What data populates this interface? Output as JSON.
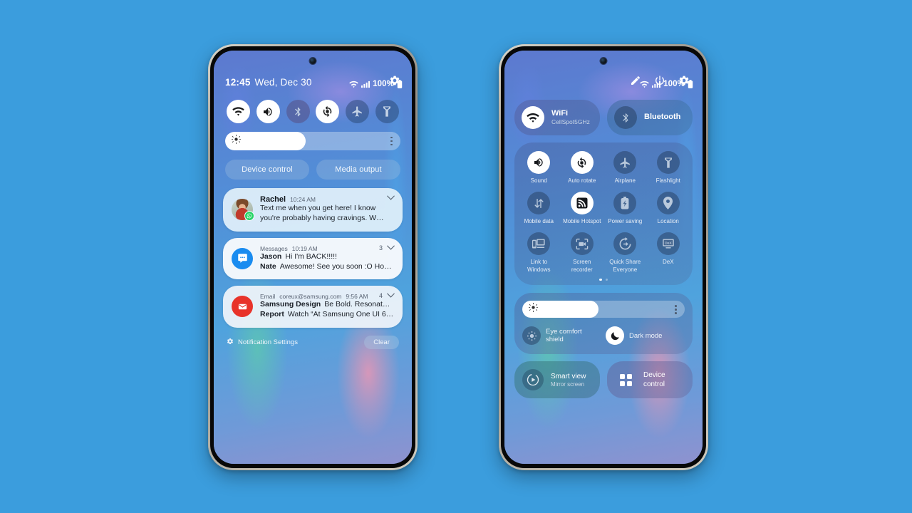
{
  "canvas": {
    "background_color": "#3b9ddd"
  },
  "left_phone": {
    "status_bar": {
      "battery": "100%",
      "icons": [
        "wifi-icon",
        "signal-icon",
        "battery-icon"
      ]
    },
    "quick_panel": {
      "time": "12:45",
      "date": "Wed, Dec 30",
      "settings_icon": "gear-icon",
      "toggles": [
        {
          "name": "wifi",
          "icon": "wifi-icon",
          "active": true
        },
        {
          "name": "sound",
          "icon": "sound-icon",
          "active": true
        },
        {
          "name": "bluetooth",
          "icon": "bluetooth-icon",
          "active": false
        },
        {
          "name": "auto-rotate",
          "icon": "auto-rotate-icon",
          "active": true
        },
        {
          "name": "airplane",
          "icon": "airplane-icon",
          "active": false
        },
        {
          "name": "flashlight",
          "icon": "flashlight-icon",
          "active": false
        }
      ],
      "brightness": {
        "value_percent": 46,
        "icon": "brightness-icon",
        "menu_icon": "more-vertical-icon"
      },
      "buttons": [
        {
          "label": "Device control"
        },
        {
          "label": "Media output"
        }
      ]
    },
    "notifications": [
      {
        "app": "",
        "sender": "Rachel",
        "time": "10:24 AM",
        "count": "",
        "icon": "avatar",
        "badge": "whatsapp-badge-icon",
        "lines": [
          {
            "name": "",
            "text": "Text me when you get here! I know"
          },
          {
            "name": "",
            "text": "you're probably having cravings. W…"
          }
        ]
      },
      {
        "app": "Messages",
        "sender": "",
        "time": "10:19 AM",
        "count": "3",
        "icon": "messages-icon",
        "badge": "",
        "lines": [
          {
            "name": "Jason",
            "text": "Hi I'm BACK!!!!!"
          },
          {
            "name": "Nate",
            "text": "Awesome! See you soon :O Hop…"
          }
        ]
      },
      {
        "app": "Email",
        "sender": "coreux@samsung.com",
        "time": "9:56 AM",
        "count": "4",
        "icon": "email-icon",
        "badge": "",
        "lines": [
          {
            "name": "Samsung Design",
            "text": "Be Bold. Resonate w…"
          },
          {
            "name": "Report",
            "text": "Watch “At Samsung One UI 6.0…"
          }
        ]
      }
    ],
    "notification_footer": {
      "settings_label": "Notification Settings",
      "settings_icon": "gear-icon",
      "clear_label": "Clear"
    },
    "nav_bar": {
      "recents": "recents-icon",
      "home": "home-icon",
      "back": "back-icon"
    }
  },
  "right_phone": {
    "status_bar": {
      "battery": "100%",
      "icons": [
        "wifi-icon",
        "signal-icon",
        "battery-icon"
      ]
    },
    "header_actions": [
      {
        "name": "edit",
        "icon": "pencil-icon"
      },
      {
        "name": "power",
        "icon": "power-icon"
      },
      {
        "name": "settings",
        "icon": "gear-icon"
      }
    ],
    "connectivity": [
      {
        "title": "WiFi",
        "subtitle": "CellSpot5GHz",
        "icon": "wifi-icon",
        "active": true
      },
      {
        "title": "Bluetooth",
        "subtitle": "",
        "icon": "bluetooth-icon",
        "active": false
      }
    ],
    "quick_settings": [
      {
        "label": "Sound",
        "icon": "sound-icon",
        "active": true
      },
      {
        "label": "Auto rotate",
        "icon": "auto-rotate-icon",
        "active": true
      },
      {
        "label": "Airplane",
        "icon": "airplane-icon",
        "active": false
      },
      {
        "label": "Flashlight",
        "icon": "flashlight-icon",
        "active": false
      },
      {
        "label": "Mobile data",
        "icon": "mobile-data-icon",
        "active": false
      },
      {
        "label": "Mobile Hotspot",
        "icon": "hotspot-icon",
        "active": true
      },
      {
        "label": "Power saving",
        "icon": "power-saving-icon",
        "active": false
      },
      {
        "label": "Location",
        "icon": "location-icon",
        "active": false
      },
      {
        "label": "Link to Windows",
        "icon": "link-to-windows-icon",
        "active": false
      },
      {
        "label": "Screen recorder",
        "icon": "screen-recorder-icon",
        "active": false
      },
      {
        "label": "Quick Share Everyone",
        "icon": "quick-share-icon",
        "active": false
      },
      {
        "label": "DeX",
        "icon": "dex-icon",
        "active": false
      }
    ],
    "page_indicator": {
      "pages": 2,
      "current": 1
    },
    "brightness": {
      "value_percent": 47,
      "icon": "brightness-icon",
      "menu_icon": "more-vertical-icon"
    },
    "display_toggles": [
      {
        "label": "Eye comfort shield",
        "icon": "eye-comfort-icon",
        "active": false
      },
      {
        "label": "Dark mode",
        "icon": "moon-icon",
        "active": true
      }
    ],
    "bottom_cards": [
      {
        "title": "Smart view",
        "subtitle": "Mirror screen",
        "icon": "smart-view-icon"
      },
      {
        "title": "Device control",
        "subtitle": "",
        "icon": "device-control-icon"
      }
    ],
    "nav_bar": {
      "recents": "recents-icon",
      "home": "home-icon",
      "back": "back-icon"
    }
  }
}
